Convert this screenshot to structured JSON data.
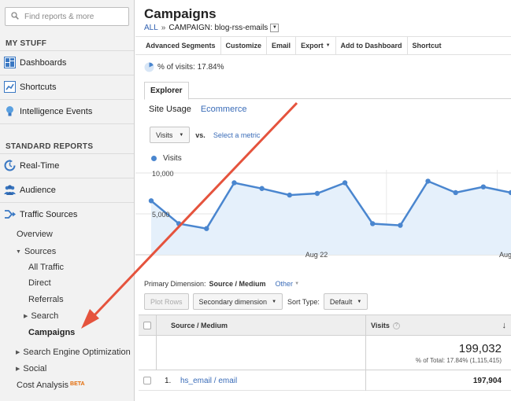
{
  "sidebar": {
    "search_placeholder": "Find reports & more",
    "my_stuff_heading": "MY STUFF",
    "my_stuff_items": [
      {
        "label": "Dashboards",
        "icon": "dashboard-icon"
      },
      {
        "label": "Shortcuts",
        "icon": "shortcut-icon"
      },
      {
        "label": "Intelligence Events",
        "icon": "lightbulb-icon"
      }
    ],
    "standard_heading": "STANDARD REPORTS",
    "standard_items": [
      {
        "label": "Real-Time",
        "icon": "realtime-icon"
      },
      {
        "label": "Audience",
        "icon": "audience-icon"
      },
      {
        "label": "Traffic Sources",
        "icon": "traffic-sources-icon"
      }
    ],
    "traffic_sub": {
      "overview": "Overview",
      "sources": "Sources",
      "all_traffic": "All Traffic",
      "direct": "Direct",
      "referrals": "Referrals",
      "search": "Search",
      "campaigns": "Campaigns",
      "seo": "Search Engine Optimization",
      "social": "Social",
      "cost_analysis": "Cost Analysis",
      "beta": "BETA"
    }
  },
  "main": {
    "title": "Campaigns",
    "breadcrumb": {
      "all": "ALL",
      "sep": "»",
      "campaign": "CAMPAIGN: blog-rss-emails"
    },
    "toolbar": [
      {
        "label": "Advanced Segments",
        "caret": false
      },
      {
        "label": "Customize",
        "caret": false
      },
      {
        "label": "Email",
        "caret": false
      },
      {
        "label": "Export",
        "caret": true
      },
      {
        "label": "Add to Dashboard",
        "caret": false
      },
      {
        "label": "Shortcut",
        "caret": false
      }
    ],
    "segment_text": "% of visits: 17.84%",
    "tab_explorer": "Explorer",
    "subtabs": {
      "site_usage": "Site Usage",
      "ecommerce": "Ecommerce"
    },
    "metric_select": "Visits",
    "vs": "vs.",
    "select_metric": "Select a metric",
    "primary_dimension_label": "Primary Dimension:",
    "primary_dimension_value": "Source / Medium",
    "other_label": "Other",
    "controls": {
      "plot_rows": "Plot Rows",
      "secondary_dimension": "Secondary dimension",
      "sort_type_label": "Sort Type:",
      "sort_type_value": "Default"
    },
    "table": {
      "col_source": "Source / Medium",
      "col_visits": "Visits",
      "help_icon": "?",
      "sort_icon": "↓",
      "total": "199,032",
      "total_pct": "% of Total: 17.84% (1,115,415)",
      "rows": [
        {
          "index": "1.",
          "source": "hs_email / email",
          "visits": "197,904"
        }
      ]
    }
  },
  "chart_data": {
    "type": "area",
    "series": [
      {
        "name": "Visits",
        "values": [
          6600,
          3800,
          3200,
          8800,
          8100,
          7300,
          7500,
          8800,
          3800,
          3600,
          9000,
          7600,
          8300,
          7600
        ]
      }
    ],
    "x_tick_labels": [
      "Aug 22",
      "Aug"
    ],
    "y_tick_labels": [
      "10,000",
      "5,000"
    ],
    "ylim": [
      0,
      10000
    ],
    "color": "#4a86cf",
    "fill": "#e5f0fb",
    "grid": true
  }
}
